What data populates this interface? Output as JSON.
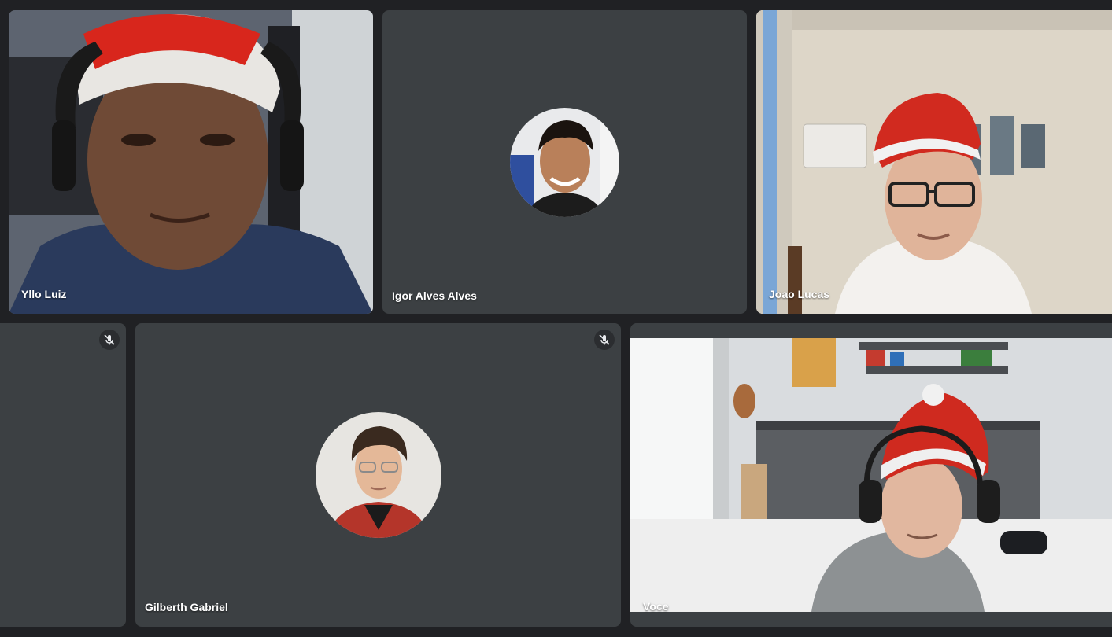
{
  "participants": {
    "yllo": {
      "name": "Yllo Luiz"
    },
    "igor": {
      "name": "Igor Alves Alves"
    },
    "joao": {
      "name": "Joao Lucas"
    },
    "gilberth": {
      "name": "Gilberth Gabriel"
    },
    "voce": {
      "name": "Voce"
    }
  },
  "icons": {
    "muted": "mic-off-icon"
  },
  "colors": {
    "background": "#202124",
    "tile": "#3c4043",
    "name_text": "#ffffff"
  }
}
